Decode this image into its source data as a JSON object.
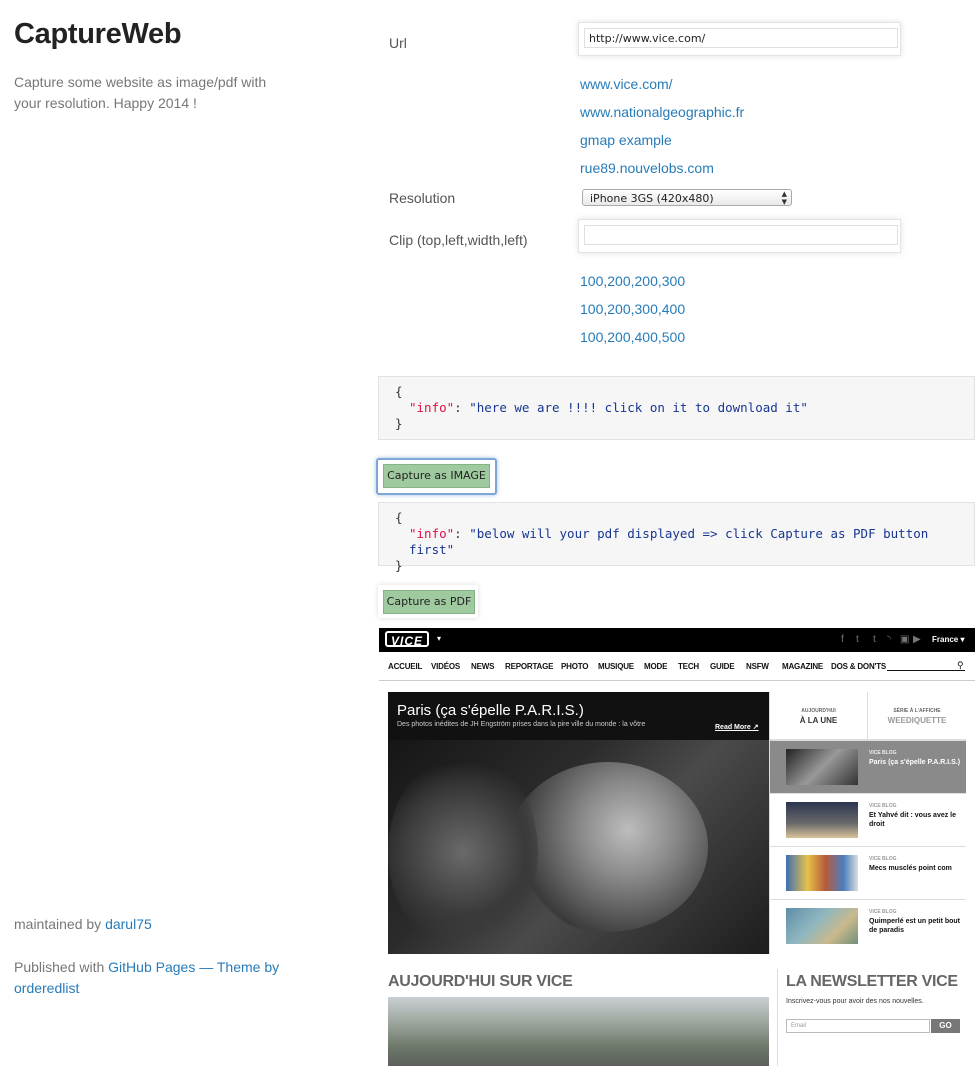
{
  "site": {
    "title": "CaptureWeb",
    "tagline": "Capture some website as image/pdf with your resolution. Happy 2014 !"
  },
  "form": {
    "url_label": "Url",
    "url_value": "http://www.vice.com/",
    "url_examples": [
      "www.vice.com/",
      "www.nationalgeographic.fr",
      "gmap example",
      "rue89.nouvelobs.com"
    ],
    "resolution_label": "Resolution",
    "resolution_selected": "iPhone 3GS (420x480)",
    "clip_label": "Clip (top,left,width,left)",
    "clip_value": "",
    "clip_examples": [
      "100,200,200,300",
      "100,200,300,400",
      "100,200,400,500"
    ]
  },
  "code_blocks": [
    {
      "open": "{",
      "key": "\"info\"",
      "sep": ": ",
      "value": "\"here we are !!!! click on it to download it\"",
      "close": "}"
    },
    {
      "open": "{",
      "key": "\"info\"",
      "sep": ": ",
      "value": "\"below will your pdf displayed => click Capture as PDF button first\"",
      "close": "}"
    }
  ],
  "buttons": {
    "capture_image": "Capture as IMAGE",
    "capture_pdf": "Capture as PDF"
  },
  "preview": {
    "logo": "VICE",
    "caret": "▾",
    "social_icons": [
      "f",
      "t",
      "t",
      "rss",
      "yt"
    ],
    "lang": "France ▾",
    "nav": [
      "ACCUEIL",
      "VIDÉOS",
      "NEWS",
      "REPORTAGE",
      "PHOTO",
      "MUSIQUE",
      "MODE",
      "TECH",
      "GUIDE",
      "NSFW",
      "MAGAZINE",
      "DOS & DON'TS"
    ],
    "hero_title": "Paris (ça s'épelle P.A.R.I.S.)",
    "hero_sub": "Des photos inédites de JH Engström prises dans la pire ville du monde : la vôtre",
    "hero_more": "Read More ↗",
    "tab1_small": "AUJOURD'HUI",
    "tab1_big": "À LA UNE",
    "tab2_small": "SÉRIE À L'AFFICHE",
    "tab2_big": "WEEDIQUETTE",
    "side_items": [
      {
        "cat": "VICE BLOG",
        "text": "Paris (ça s'épelle P.A.R.I.S.)"
      },
      {
        "cat": "VICE BLOG",
        "text": "Et Yahvé dit : vous avez le droit"
      },
      {
        "cat": "VICE BLOG",
        "text": "Mecs musclés point com"
      },
      {
        "cat": "VICE BLOG",
        "text": "Quimperlé est un petit bout de paradis"
      }
    ],
    "section_title": "AUJOURD'HUI SUR VICE",
    "newsletter_title": "LA NEWSLETTER VICE",
    "newsletter_sub": "Inscrivez-vous pour avoir des nos nouvelles.",
    "email_placeholder": "Email",
    "go": "GO"
  },
  "footer": {
    "maintained_prefix": "maintained by ",
    "maintainer": "darul75",
    "published_prefix": "Published with ",
    "github_pages": "GitHub Pages",
    "theme_sep": " — Theme by ",
    "theme_author": "orderedlist"
  },
  "colors": {
    "link": "#267CB9",
    "button": "#9fca9f",
    "focus": "#7ea6d6"
  }
}
